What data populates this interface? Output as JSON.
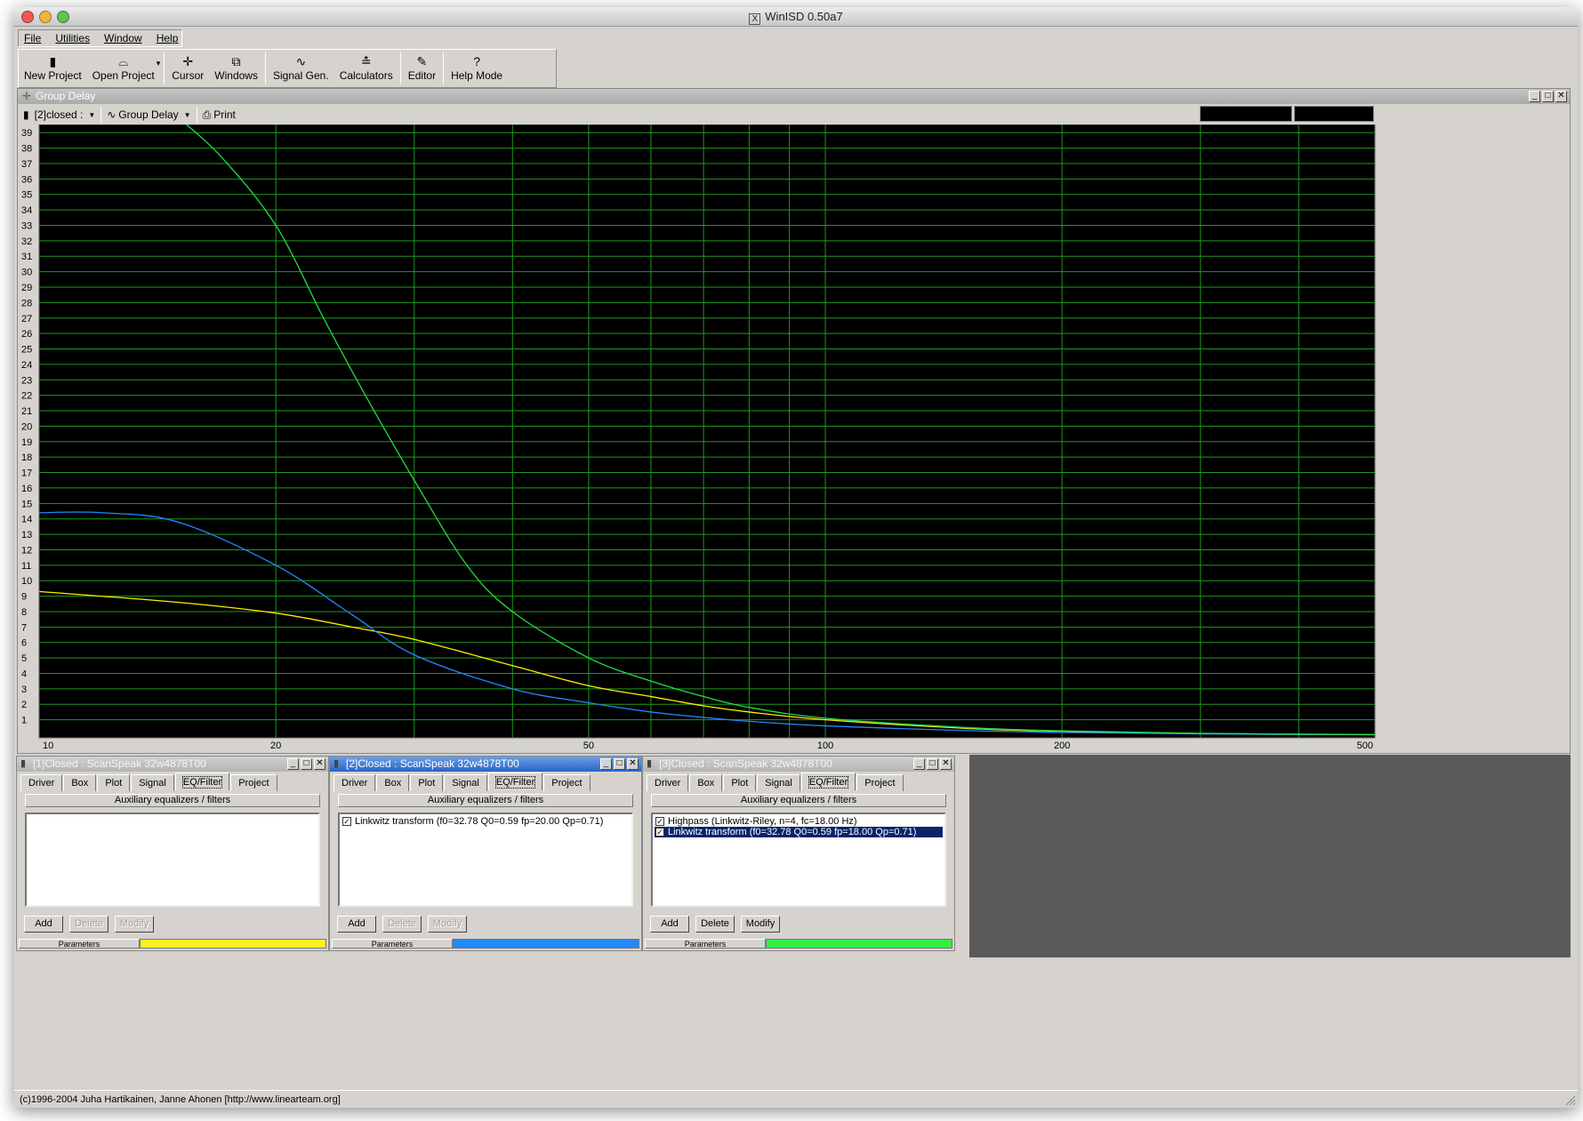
{
  "app": {
    "title": "WinISD 0.50a7",
    "menu": [
      "File",
      "Utilities",
      "Window",
      "Help"
    ],
    "toolbar": [
      {
        "label": "New Project",
        "icon": "new-project-icon",
        "glyph": "▮"
      },
      {
        "label": "Open Project",
        "icon": "open-folder-icon",
        "glyph": "⌓"
      },
      {
        "label": "Cursor",
        "icon": "cursor-icon",
        "glyph": "✛"
      },
      {
        "label": "Windows",
        "icon": "windows-icon",
        "glyph": "⧉"
      },
      {
        "label": "Signal Gen.",
        "icon": "signal-wave-icon",
        "glyph": "∿"
      },
      {
        "label": "Calculators",
        "icon": "calculator-icon",
        "glyph": "≛"
      },
      {
        "label": "Editor",
        "icon": "editor-icon",
        "glyph": "✎"
      },
      {
        "label": "Help Mode",
        "icon": "help-icon",
        "glyph": "?"
      }
    ],
    "status_text": "(c)1996-2004 Juha Hartikainen, Janne Ahonen [http://www.linearteam.org]"
  },
  "group_delay_window": {
    "title": "Group Delay",
    "project_selector": "[2]closed :",
    "plot_selector": "Group Delay",
    "print_label": "Print"
  },
  "chart_data": {
    "type": "line",
    "title": "",
    "xlabel": "",
    "ylabel": "",
    "x_scale": "log",
    "xlim": [
      10,
      500
    ],
    "ylim": [
      0,
      40
    ],
    "x_ticks": [
      10,
      20,
      50,
      100,
      200,
      500
    ],
    "y_ticks": [
      1,
      2,
      3,
      4,
      5,
      6,
      7,
      8,
      9,
      10,
      11,
      12,
      13,
      14,
      15,
      16,
      17,
      18,
      19,
      20,
      21,
      22,
      23,
      24,
      25,
      26,
      27,
      28,
      29,
      30,
      31,
      32,
      33,
      34,
      35,
      36,
      37,
      38,
      39
    ],
    "grid": true,
    "series": [
      {
        "color": "#ffee00",
        "x": [
          10,
          15,
          20,
          25,
          30,
          40,
          50,
          60,
          70,
          80,
          100,
          150,
          200,
          300,
          500
        ],
        "y": [
          9.3,
          8.6,
          7.9,
          7.0,
          6.2,
          4.5,
          3.2,
          2.5,
          1.9,
          1.5,
          1.0,
          0.45,
          0.25,
          0.1,
          0.03
        ]
      },
      {
        "color": "#2288ff",
        "x": [
          10,
          12,
          15,
          20,
          25,
          30,
          40,
          50,
          60,
          70,
          80,
          100,
          150,
          200,
          300,
          500
        ],
        "y": [
          14.4,
          14.4,
          13.8,
          11.0,
          7.8,
          5.2,
          3.0,
          2.1,
          1.5,
          1.15,
          0.9,
          0.6,
          0.3,
          0.18,
          0.08,
          0.03
        ]
      },
      {
        "color": "#22dd44",
        "x": [
          15,
          17,
          20,
          23,
          26,
          30,
          35,
          40,
          50,
          60,
          70,
          80,
          100,
          150,
          200,
          300,
          500
        ],
        "y": [
          40,
          37.5,
          33,
          27,
          22,
          16.5,
          11,
          8,
          5,
          3.5,
          2.5,
          1.8,
          1.1,
          0.5,
          0.28,
          0.12,
          0.04
        ]
      }
    ]
  },
  "projects": [
    {
      "title": "[1]Closed : ScanSpeak 32w4878T00",
      "active": false,
      "tabs": [
        "Driver",
        "Box",
        "Plot",
        "Signal",
        "EQ/Filter",
        "Project"
      ],
      "selected_tab": "EQ/Filter",
      "header": "Auxiliary equalizers / filters",
      "filters": [],
      "buttons": {
        "add": "Add",
        "delete": "Delete",
        "modify": "Modify"
      },
      "buttons_enabled": {
        "delete": false,
        "modify": false
      },
      "params_label": "Parameters",
      "color": "#ffee22"
    },
    {
      "title": "[2]Closed : ScanSpeak 32w4878T00",
      "active": true,
      "tabs": [
        "Driver",
        "Box",
        "Plot",
        "Signal",
        "EQ/Filter",
        "Project"
      ],
      "selected_tab": "EQ/Filter",
      "header": "Auxiliary equalizers / filters",
      "filters": [
        {
          "label": "Linkwitz transform (f0=32.78 Q0=0.59 fp=20.00 Qp=0.71)",
          "checked": true,
          "selected": false
        }
      ],
      "buttons": {
        "add": "Add",
        "delete": "Delete",
        "modify": "Modify"
      },
      "buttons_enabled": {
        "delete": false,
        "modify": false
      },
      "params_label": "Parameters",
      "color": "#2288ff"
    },
    {
      "title": "[3]Closed : ScanSpeak 32w4878T00",
      "active": false,
      "tabs": [
        "Driver",
        "Box",
        "Plot",
        "Signal",
        "EQ/Filter",
        "Project"
      ],
      "selected_tab": "EQ/Filter",
      "header": "Auxiliary equalizers / filters",
      "filters": [
        {
          "label": "Highpass (Linkwitz-Riley, n=4, fc=18.00 Hz)",
          "checked": true,
          "selected": false
        },
        {
          "label": "Linkwitz transform (f0=32.78 Q0=0.59 fp=18.00 Qp=0.71)",
          "checked": true,
          "selected": true
        }
      ],
      "buttons": {
        "add": "Add",
        "delete": "Delete",
        "modify": "Modify"
      },
      "buttons_enabled": {
        "delete": true,
        "modify": true
      },
      "params_label": "Parameters",
      "color": "#33ee44"
    }
  ]
}
